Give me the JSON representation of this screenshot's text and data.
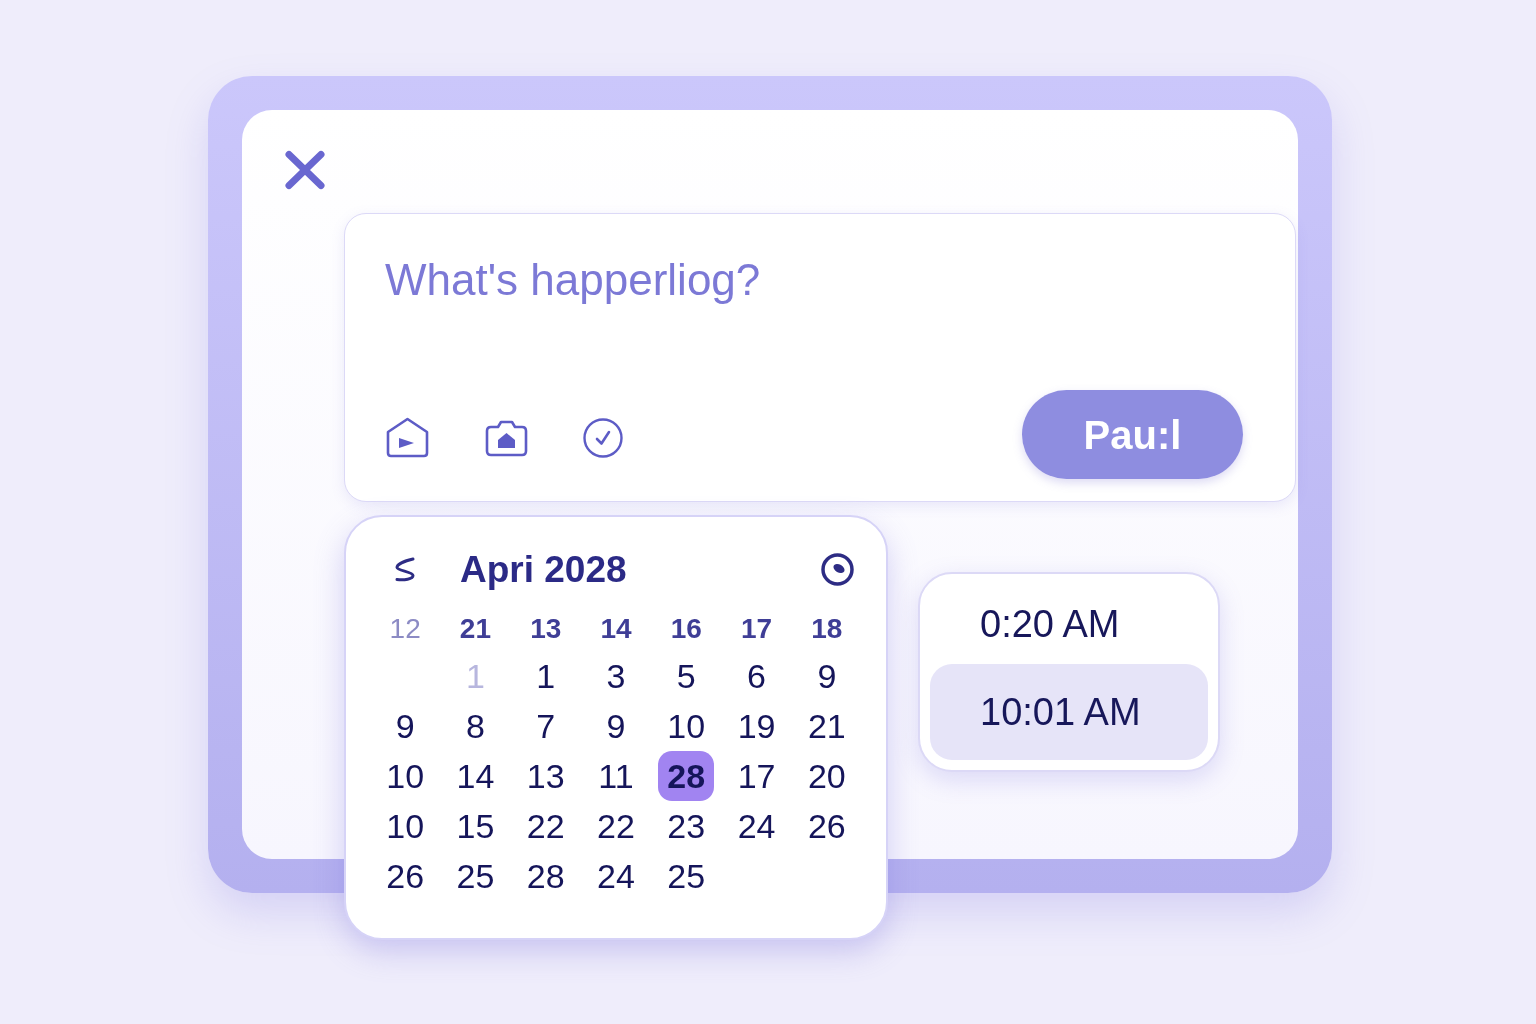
{
  "composer": {
    "placeholder": "What's happerliog?",
    "post_button": {
      "label": "Pau:l"
    }
  },
  "calendar": {
    "title": "Apri 2028",
    "header": [
      {
        "label": "12",
        "muted": true
      },
      {
        "label": "21",
        "muted": false
      },
      {
        "label": "13",
        "muted": false
      },
      {
        "label": "14",
        "muted": false
      },
      {
        "label": "16",
        "muted": false
      },
      {
        "label": "17",
        "muted": false
      },
      {
        "label": "18",
        "muted": false
      }
    ],
    "weeks": [
      [
        {
          "kind": "blank"
        },
        {
          "kind": "day",
          "label": "1",
          "muted": true,
          "selected": false
        },
        {
          "kind": "day",
          "label": "1",
          "muted": false,
          "selected": false
        },
        {
          "kind": "day",
          "label": "3",
          "muted": false,
          "selected": false
        },
        {
          "kind": "day",
          "label": "5",
          "muted": false,
          "selected": false
        },
        {
          "kind": "day",
          "label": "6",
          "muted": false,
          "selected": false
        },
        {
          "kind": "day",
          "label": "9",
          "muted": false,
          "selected": false
        }
      ],
      [
        {
          "kind": "day",
          "label": "9",
          "muted": false,
          "selected": false
        },
        {
          "kind": "day",
          "label": "8",
          "muted": false,
          "selected": false
        },
        {
          "kind": "day",
          "label": "7",
          "muted": false,
          "selected": false
        },
        {
          "kind": "day",
          "label": "9",
          "muted": false,
          "selected": false
        },
        {
          "kind": "day",
          "label": "10",
          "muted": false,
          "selected": false
        },
        {
          "kind": "day",
          "label": "19",
          "muted": false,
          "selected": false
        },
        {
          "kind": "day",
          "label": "21",
          "muted": false,
          "selected": false
        }
      ],
      [
        {
          "kind": "day",
          "label": "10",
          "muted": false,
          "selected": false
        },
        {
          "kind": "day",
          "label": "14",
          "muted": false,
          "selected": false
        },
        {
          "kind": "day",
          "label": "13",
          "muted": false,
          "selected": false
        },
        {
          "kind": "day",
          "label": "11",
          "muted": false,
          "selected": false
        },
        {
          "kind": "day",
          "label": "28",
          "muted": false,
          "selected": true
        },
        {
          "kind": "day",
          "label": "17",
          "muted": false,
          "selected": false
        },
        {
          "kind": "day",
          "label": "20",
          "muted": false,
          "selected": false
        }
      ],
      [
        {
          "kind": "day",
          "label": "10",
          "muted": false,
          "selected": false
        },
        {
          "kind": "day",
          "label": "15",
          "muted": false,
          "selected": false
        },
        {
          "kind": "day",
          "label": "22",
          "muted": false,
          "selected": false
        },
        {
          "kind": "day",
          "label": "22",
          "muted": false,
          "selected": false
        },
        {
          "kind": "day",
          "label": "23",
          "muted": false,
          "selected": false
        },
        {
          "kind": "day",
          "label": "24",
          "muted": false,
          "selected": false
        },
        {
          "kind": "day",
          "label": "26",
          "muted": false,
          "selected": false
        }
      ],
      [
        {
          "kind": "day",
          "label": "26",
          "muted": false,
          "selected": false
        },
        {
          "kind": "day",
          "label": "25",
          "muted": false,
          "selected": false
        },
        {
          "kind": "day",
          "label": "28",
          "muted": false,
          "selected": false
        },
        {
          "kind": "day",
          "label": "24",
          "muted": false,
          "selected": false
        },
        {
          "kind": "day",
          "label": "25",
          "muted": false,
          "selected": false
        }
      ]
    ]
  },
  "time_picker": {
    "options": [
      {
        "label": "0:20 AM",
        "selected": false
      },
      {
        "label": "10:01 AM",
        "selected": true
      }
    ]
  }
}
